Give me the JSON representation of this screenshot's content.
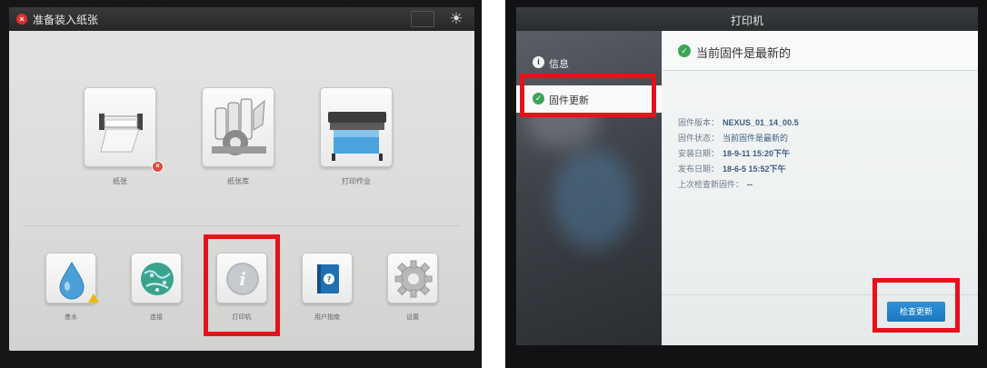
{
  "left_screen": {
    "status": {
      "message": "准备装入纸张"
    },
    "main_tiles": [
      {
        "label": "纸张",
        "icon": "paper-roll-icon",
        "badge": "×"
      },
      {
        "label": "纸张库",
        "icon": "paper-library-icon"
      },
      {
        "label": "打印作业",
        "icon": "printer-large-icon"
      }
    ],
    "small_tiles": [
      {
        "label": "墨水",
        "icon": "ink-drop-icon",
        "badge": "!"
      },
      {
        "label": "连接",
        "icon": "globe-network-icon"
      },
      {
        "label": "打印机",
        "icon": "info-icon"
      },
      {
        "label": "用户指南",
        "icon": "user-guide-icon"
      },
      {
        "label": "设置",
        "icon": "gear-icon"
      }
    ]
  },
  "right_screen": {
    "title": "打印机",
    "sidebar": [
      {
        "label": "信息",
        "icon": "info-icon"
      },
      {
        "label": "固件更新",
        "icon": "check-circle-icon"
      }
    ],
    "content": {
      "title": "当前固件是最新的",
      "rows": [
        {
          "label": "固件版本：",
          "value": "NEXUS_01_14_00.5"
        },
        {
          "label": "固件状态：",
          "value": "当前固件是最新的"
        },
        {
          "label": "安装日期：",
          "value": "18-9-11 15:20下午"
        },
        {
          "label": "发布日期：",
          "value": "18-6-5 15:52下午"
        },
        {
          "label": "上次检查新固件：",
          "value": "--"
        }
      ],
      "check_button": "检查更新"
    }
  },
  "colors": {
    "highlight": "#e8101a",
    "accent_blue": "#1c75bd",
    "ok_green": "#3aa655",
    "error_red": "#d8322a"
  }
}
